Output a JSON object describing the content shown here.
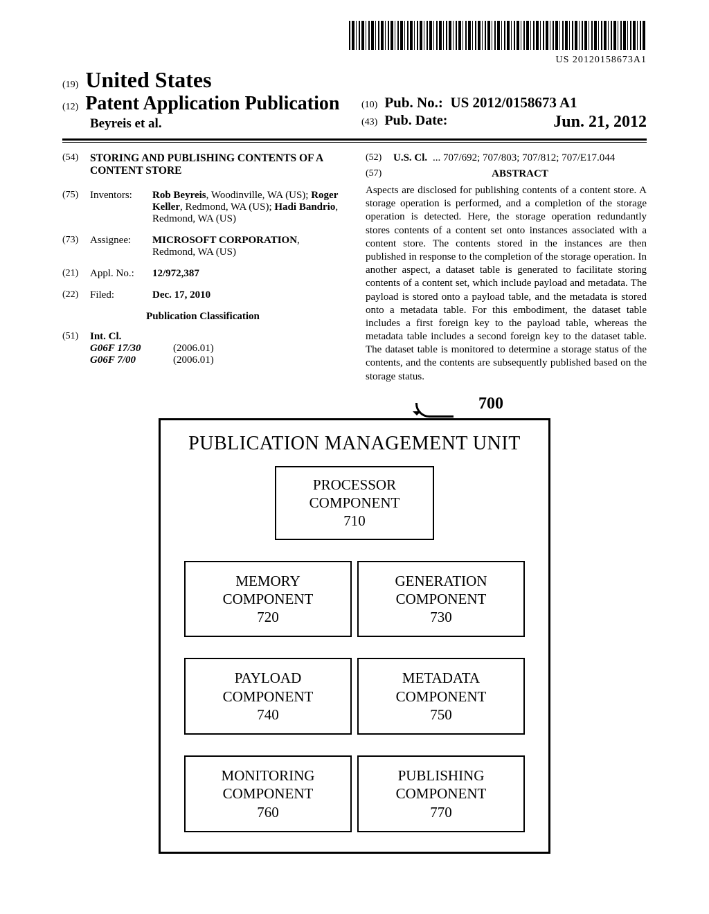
{
  "barcode_label": "US 20120158673A1",
  "header": {
    "code19": "(19)",
    "country": "United States",
    "code12": "(12)",
    "pub_type": "Patent Application Publication",
    "authors": "Beyreis et al.",
    "code10": "(10)",
    "pubno_label": "Pub. No.:",
    "pubno": "US 2012/0158673 A1",
    "code43": "(43)",
    "pubdate_label": "Pub. Date:",
    "pubdate": "Jun. 21, 2012"
  },
  "left_col": {
    "code54": "(54)",
    "title": "STORING AND PUBLISHING CONTENTS OF A CONTENT STORE",
    "code75": "(75)",
    "inventors_label": "Inventors:",
    "inventors_html": "<b>Rob Beyreis</b>, Woodinville, WA (US); <b>Roger Keller</b>, Redmond, WA (US); <b>Hadi Bandrio</b>, Redmond, WA (US)",
    "code73": "(73)",
    "assignee_label": "Assignee:",
    "assignee_html": "<b>MICROSOFT CORPORATION</b>, Redmond, WA (US)",
    "code21": "(21)",
    "applno_label": "Appl. No.:",
    "applno": "12/972,387",
    "code22": "(22)",
    "filed_label": "Filed:",
    "filed": "Dec. 17, 2010",
    "pub_class": "Publication Classification",
    "code51": "(51)",
    "intcl_label": "Int. Cl.",
    "intcl": [
      {
        "cls": "G06F 17/30",
        "yr": "(2006.01)"
      },
      {
        "cls": "G06F 7/00",
        "yr": "(2006.01)"
      }
    ]
  },
  "right_col": {
    "code52": "(52)",
    "uscl_label": "U.S. Cl.",
    "uscl_value": " ...  707/692; 707/803; 707/812; 707/E17.044",
    "code57": "(57)",
    "abstract_label": "ABSTRACT",
    "abstract": "Aspects are disclosed for publishing contents of a content store. A storage operation is performed, and a completion of the storage operation is detected. Here, the storage operation redundantly stores contents of a content set onto instances associated with a content store. The contents stored in the instances are then published in response to the completion of the storage operation. In another aspect, a dataset table is generated to facilitate storing contents of a content set, which include payload and metadata. The payload is stored onto a payload table, and the metadata is stored onto a metadata table. For this embodiment, the dataset table includes a first foreign key to the payload table, whereas the metadata table includes a second foreign key to the dataset table. The dataset table is monitored to determine a storage status of the contents, and the contents are subsequently published based on the storage status."
  },
  "figure": {
    "ref": "700",
    "unit_title": "PUBLICATION MANAGEMENT UNIT",
    "processor": {
      "l1": "PROCESSOR",
      "l2": "COMPONENT",
      "num": "710"
    },
    "rows": [
      [
        {
          "l1": "MEMORY",
          "l2": "COMPONENT",
          "num": "720"
        },
        {
          "l1": "GENERATION",
          "l2": "COMPONENT",
          "num": "730"
        }
      ],
      [
        {
          "l1": "PAYLOAD",
          "l2": "COMPONENT",
          "num": "740"
        },
        {
          "l1": "METADATA",
          "l2": "COMPONENT",
          "num": "750"
        }
      ],
      [
        {
          "l1": "MONITORING",
          "l2": "COMPONENT",
          "num": "760"
        },
        {
          "l1": "PUBLISHING",
          "l2": "COMPONENT",
          "num": "770"
        }
      ]
    ]
  }
}
